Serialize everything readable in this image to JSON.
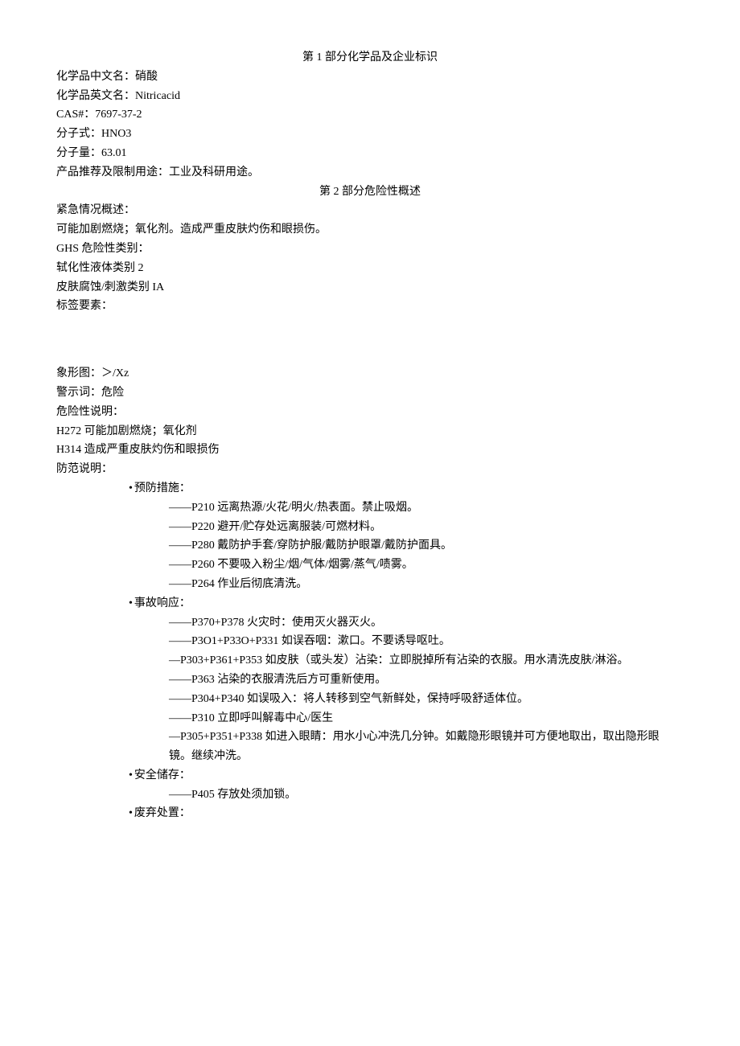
{
  "section1": {
    "title": "第 1 部分化学品及企业标识",
    "lines": [
      "化学品中文名：硝酸",
      "化学品英文名：Nitricacid",
      "CAS#：7697-37-2",
      "分子式：HNO3",
      "分子量：63.01",
      "产品推荐及限制用途：工业及科研用途。"
    ]
  },
  "section2": {
    "title": "第 2 部分危险性概述",
    "pre_lines": [
      "紧急情况概述：",
      "可能加剧燃烧；氧化剂。造成严重皮肤灼伤和眼损伤。",
      "GHS 危险性类别：",
      "轼化性液体类别 2",
      "皮肤腐蚀/刺激类别 IA",
      "标签要素："
    ],
    "post_lines": [
      "象形图：＞/Xz",
      "警示词：危险",
      "危险性说明：",
      "H272 可能加剧燃烧；氧化剂",
      "H314 造成严重皮肤灼伤和眼损伤",
      "防范说明："
    ],
    "prevention": {
      "label": "预防措施：",
      "items": [
        "P210 远离热源/火花/明火/热表面。禁止吸烟。",
        "P220 避开/贮存处远离服装/可燃材料。",
        "P280 戴防护手套/穿防护服/戴防护眼罩/戴防护面具。",
        "P260 不要吸入粉尘/烟/气体/烟雾/蒸气/啧雾。",
        "P264 作业后彻底清洗。"
      ]
    },
    "response": {
      "label": "事故响应：",
      "items": [
        {
          "type": "dash",
          "text": "P370+P378 火灾时：使用灭火器灭火。"
        },
        {
          "type": "dash",
          "text": "P3O1+P33O+P331 如误吞咽：漱口。不要诱导呕吐。"
        },
        {
          "type": "sdash_wrap",
          "text": "P303+P361+P353 如皮肤（或头发）沾染：立即脱掉所有沾染的衣服。用水清洗皮肤/淋浴。"
        },
        {
          "type": "dash",
          "text": "P363 沾染的衣服清洗后方可重新使用。"
        },
        {
          "type": "dash",
          "text": "P304+P340 如误吸入：将人转移到空气新鲜处，保持呼吸舒适体位。"
        },
        {
          "type": "dash",
          "text": "P310 立即呼叫解毒中心/医生"
        },
        {
          "type": "sdash_wrap",
          "text": "P305+P351+P338 如进入眼睛：用水小心冲洗几分钟。如戴隐形眼镜并可方便地取出，取出隐形眼镜。继续冲洗。"
        }
      ]
    },
    "storage": {
      "label": "安全储存：",
      "items": [
        "P405 存放处须加锁。"
      ]
    },
    "disposal": {
      "label": "废弃处置："
    }
  }
}
